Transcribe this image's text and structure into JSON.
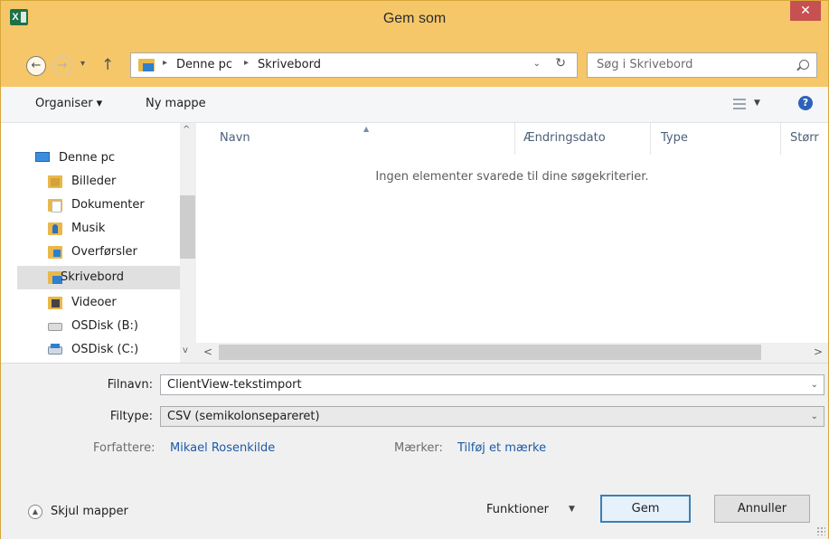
{
  "window": {
    "title": "Gem som",
    "app_icon_letter": "X",
    "close_glyph": "✕"
  },
  "address": {
    "back_glyph": "←",
    "forward_glyph": "→",
    "recent_glyph": "▾",
    "up_glyph": "↑",
    "breadcrumb": [
      "Denne pc",
      "Skrivebord"
    ],
    "separator": "▸",
    "dropdown_glyph": "⌄",
    "refresh_glyph": "↻"
  },
  "search": {
    "placeholder": "Søg i Skrivebord"
  },
  "toolbar": {
    "organise_label": "Organiser ▾",
    "new_folder_label": "Ny mappe",
    "view_dd_glyph": "▼",
    "help_glyph": "?"
  },
  "navigation": {
    "items": [
      {
        "label": "Denne pc",
        "icon": "computer-icon"
      },
      {
        "label": "Billeder",
        "icon": "pictures-folder-icon"
      },
      {
        "label": "Dokumenter",
        "icon": "documents-folder-icon"
      },
      {
        "label": "Musik",
        "icon": "music-folder-icon"
      },
      {
        "label": "Overførsler",
        "icon": "downloads-folder-icon"
      },
      {
        "label": "Skrivebord",
        "icon": "desktop-folder-icon",
        "selected": true
      },
      {
        "label": "Videoer",
        "icon": "videos-folder-icon"
      },
      {
        "label": "OSDisk (B:)",
        "icon": "drive-icon"
      },
      {
        "label": "OSDisk (C:)",
        "icon": "system-drive-icon"
      }
    ],
    "scroll_up_glyph": "^",
    "scroll_down_glyph": "v"
  },
  "file_list": {
    "columns": [
      "Navn",
      "Ændringsdato",
      "Type",
      "Størr"
    ],
    "sort_glyph": "▲",
    "empty_message": "Ingen elementer svarede til dine søgekriterier.",
    "scroll_left_glyph": "<",
    "scroll_right_glyph": ">"
  },
  "form": {
    "filename_label": "Filnavn:",
    "filename_value": "ClientView-tekstimport",
    "filetype_label": "Filtype:",
    "filetype_value": "CSV (semikolonsepareret)",
    "dd_glyph": "⌄",
    "authors_label": "Forfattere:",
    "authors_value": "Mikael Rosenkilde",
    "tags_label": "Mærker:",
    "tags_value": "Tilføj et mærke"
  },
  "footer": {
    "hide_folders_label": "Skjul mapper",
    "hide_folders_glyph": "▲",
    "functions_label": "Funktioner",
    "functions_dd_glyph": "▼",
    "save_label": "Gem",
    "cancel_label": "Annuller"
  },
  "colors": {
    "titlebar": "#f6c768",
    "close": "#c75050",
    "selected_nav": "#e0e0e0",
    "link": "#1d5aa6",
    "primary_border": "#3c7fb1"
  }
}
